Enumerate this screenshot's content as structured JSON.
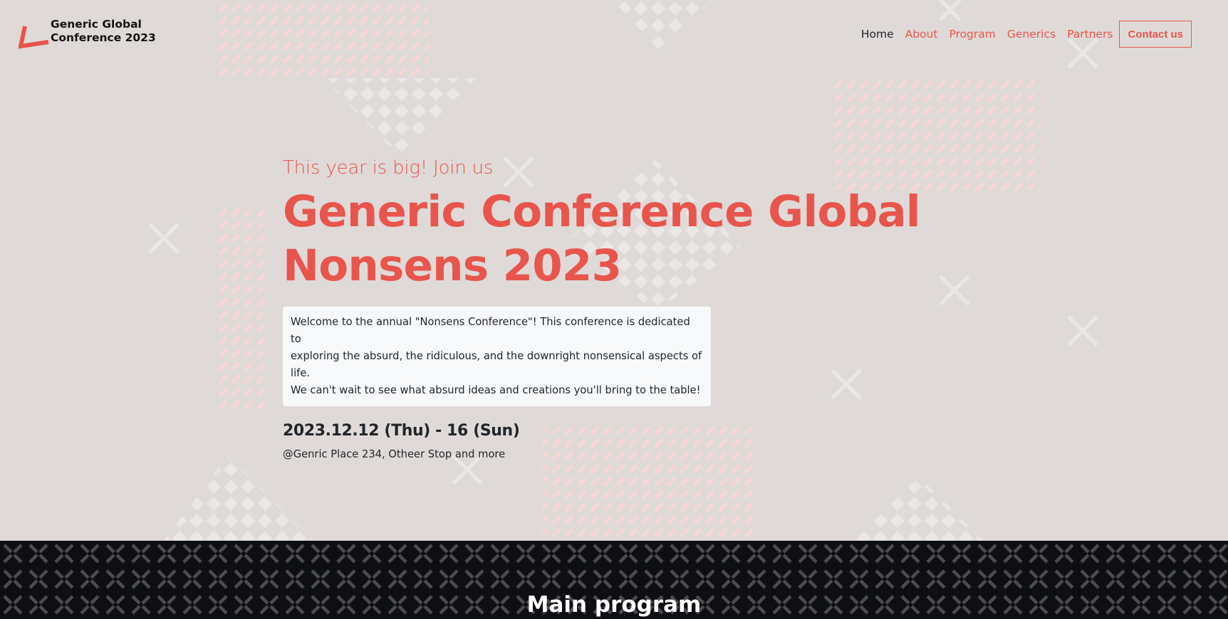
{
  "brand": {
    "name_line1": "Generic Global",
    "name_line2": "Conference 2023",
    "accent": "#e8554c"
  },
  "nav": {
    "items": [
      {
        "label": "Home",
        "active": true
      },
      {
        "label": "About",
        "active": false
      },
      {
        "label": "Program",
        "active": false
      },
      {
        "label": "Generics",
        "active": false
      },
      {
        "label": "Partners",
        "active": false
      }
    ],
    "contact_label": "Contact us"
  },
  "hero": {
    "eyebrow": "This year is big! Join us",
    "title_line1": "Generic Conference Global",
    "title_line2": "Nonsens 2023",
    "intro_line1": "Welcome to the annual \"Nonsens Conference\"! This conference is dedicated to",
    "intro_line2": "exploring the absurd, the ridiculous, and the downright nonsensical aspects of life.",
    "intro_line3": "We can't wait to see what absurd ideas and creations you'll bring to the table!",
    "dates": "2023.12.12 (Thu) - 16 (Sun)",
    "venue": "@Genric Place 234, Otheer Stop and more"
  },
  "program": {
    "title": "Main program"
  },
  "colors": {
    "page_bg": "#dfdad8",
    "dark_bg": "#0e0f12",
    "stripe": "#f7d6d4",
    "diamond": "#ebe7e6"
  }
}
